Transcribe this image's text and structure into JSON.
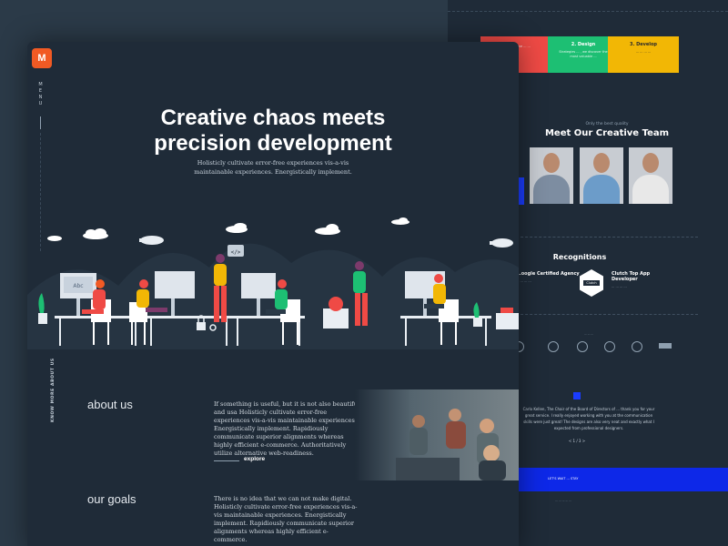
{
  "back_page": {
    "steps": [
      {
        "title": "",
        "desc": "... ... become ... ..."
      },
      {
        "title": "2. Design",
        "desc": "Strategies ... , we discover the most valuable ..."
      },
      {
        "title": "3. Develop",
        "desc": "... ... ... ..."
      }
    ],
    "team": {
      "subtitle": "Only the best quality",
      "title": "Meet Our Creative Team"
    },
    "recognitions": {
      "title": "Recognitions",
      "items": [
        {
          "title": "...oogle Certified Agency",
          "desc": "... ... ... ..."
        },
        {
          "title": "Clutch Top App Developer",
          "desc": "... ... ... ..."
        }
      ],
      "badge": "Clutch",
      "logos_label": "... ... ..."
    },
    "testimonial": {
      "badge": "M",
      "text": "Carlo Kellen, The Chair of the Board of Directors of ... thank you for your great service. I really enjoyed working with you at the communication skills were just great! The designs are also very neat and exactly what I expected from professional designers.",
      "pager": "< 1 / 3 >"
    },
    "cta": "LET'S WAIT ... STAY",
    "footer_links": "... ... ... ... ..."
  },
  "front_page": {
    "logo": "M",
    "menu_label": "MENU",
    "hero": {
      "title_line1": "Creative chaos meets",
      "title_line2": "precision development",
      "subtitle": "Holisticly cultivate error-free experiences vis-a-vis maintainable experiences. Energistically implement."
    },
    "scene": {
      "code_tag": "</>",
      "screen_label": "Abc"
    },
    "side_caption": "KNOW MORE ABOUT US",
    "about": {
      "title": "about us",
      "text": "If something is useful, but it is not also beautiful and usa Holisticly cultivate error-free experiences vis-a-vis maintainable experiences. Energistically implement. Rapidiously communicate superior alignments whereas highly efficient e-commerce. Authoritatively utilize alternative web-readiness.",
      "link": "explore"
    },
    "goals": {
      "title": "our goals",
      "text": "There is no idea that we can not make digital. Holisticly cultivate error-free experiences vis-a-vis maintainable experiences. Energistically implement. Rapidiously communicate superior alignments whereas highly efficient e-commerce."
    }
  },
  "colors": {
    "background": "#2b3a48",
    "page": "#1f2b38",
    "accent_orange": "#f15a24",
    "step_red": "#ef4a45",
    "step_green": "#1dbf73",
    "step_yellow": "#f2b705",
    "cta_blue": "#0d28e8"
  }
}
